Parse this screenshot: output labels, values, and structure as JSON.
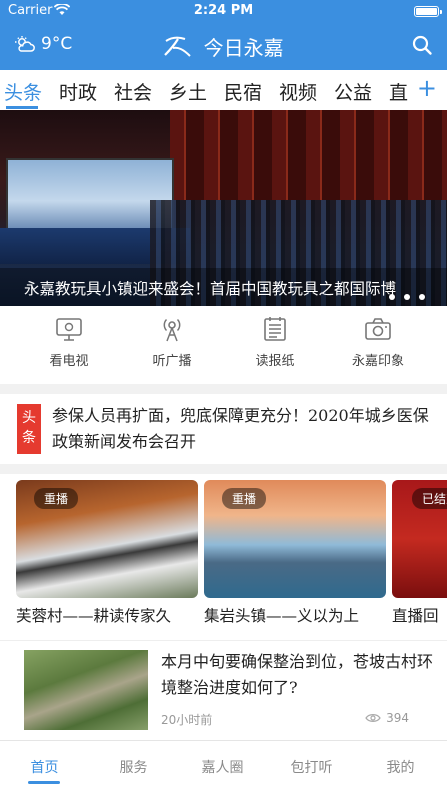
{
  "status_bar": {
    "carrier": "Carrier",
    "time": "2:24 PM"
  },
  "header": {
    "weather": "9°C",
    "app_name": "今日永嘉"
  },
  "tabs": [
    "头条",
    "时政",
    "社会",
    "乡土",
    "民宿",
    "视频",
    "公益",
    "直"
  ],
  "tabs_active_index": 0,
  "banner": {
    "caption": "永嘉教玩具小镇迎来盛会！首届中国教玩具之都国际博",
    "dots": 3
  },
  "quick_entries": [
    {
      "label": "看电视",
      "icon": "tv-icon"
    },
    {
      "label": "听广播",
      "icon": "radio-icon"
    },
    {
      "label": "读报纸",
      "icon": "newspaper-icon"
    },
    {
      "label": "永嘉印象",
      "icon": "camera-icon"
    }
  ],
  "headline": {
    "badge_line1": "头",
    "badge_line2": "条",
    "text": "参保人员再扩面，兜底保障更充分！2020年城乡医保政策新闻发布会召开"
  },
  "videos": [
    {
      "tag": "重播",
      "title": "芙蓉村——耕读传家久"
    },
    {
      "tag": "重播",
      "title": "集岩头镇——义以为上"
    },
    {
      "tag": "已结束",
      "title": "直播回"
    }
  ],
  "article": {
    "title": "本月中旬要确保整治到位，苍坡古村环境整治进度如何了?",
    "time": "20小时前",
    "views": "394"
  },
  "bottom_nav": [
    "首页",
    "服务",
    "嘉人圈",
    "包打听",
    "我的"
  ],
  "colors": {
    "brand_blue": "#3b8fe0",
    "badge_red": "#e53a2f"
  }
}
